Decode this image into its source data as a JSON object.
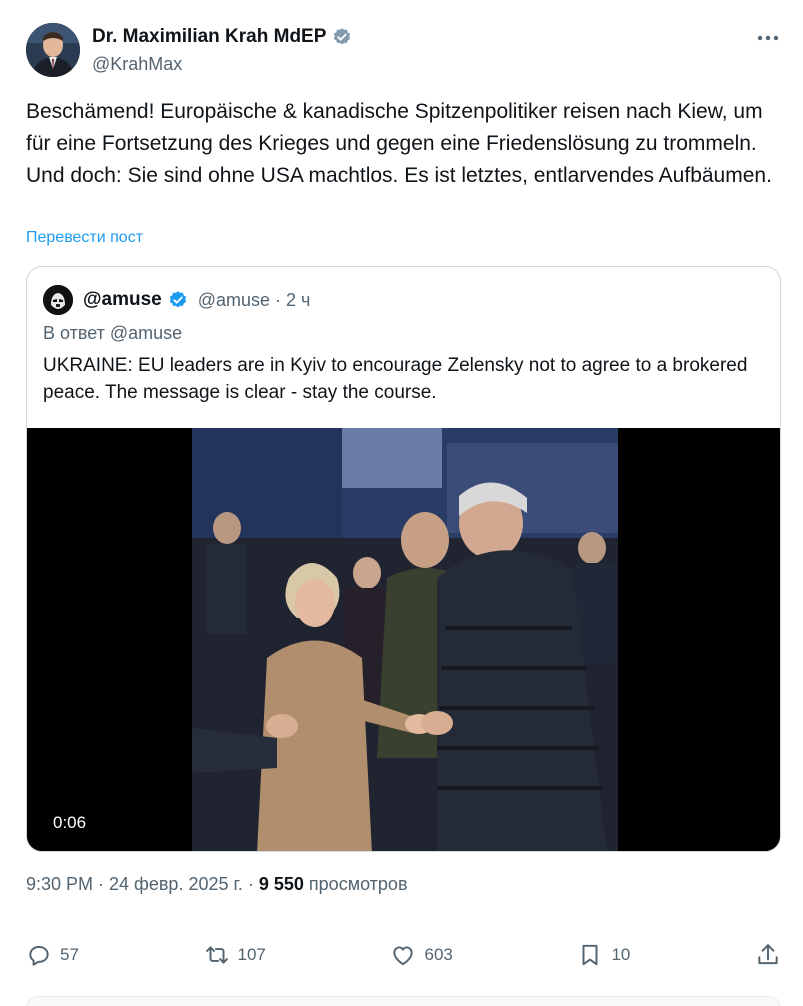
{
  "author": {
    "name": "Dr. Maximilian Krah MdEP",
    "handle": "@KrahMax"
  },
  "post": {
    "text": "Beschämend! Europäische & kanadische Spitzenpolitiker reisen nach Kiew, um für eine Fortsetzung des Krieges und gegen eine Friedenslösung zu trommeln. Und doch: Sie sind ohne USA machtlos. Es ist letztes, entlarvendes Aufbäumen.",
    "translate_label": "Перевести пост"
  },
  "quote": {
    "name": "@amuse",
    "handle_time": "@amuse · 2 ч",
    "reply_to": "В ответ @amuse",
    "text": "UKRAINE: EU leaders are in Kyiv to encourage Zelensky not to agree to a brokered peace. The message is clear - stay the course.",
    "video_duration": "0:06"
  },
  "meta": {
    "time_date": "9:30 PM · 24 февр. 2025 г. · ",
    "views_count": "9 550",
    "views_label": "просмотров"
  },
  "actions": {
    "replies": "57",
    "reposts": "107",
    "likes": "603",
    "bookmarks": "10"
  },
  "colors": {
    "accent": "#1d9bf0",
    "secondary_text": "#536471",
    "primary_text": "#0f1419"
  }
}
